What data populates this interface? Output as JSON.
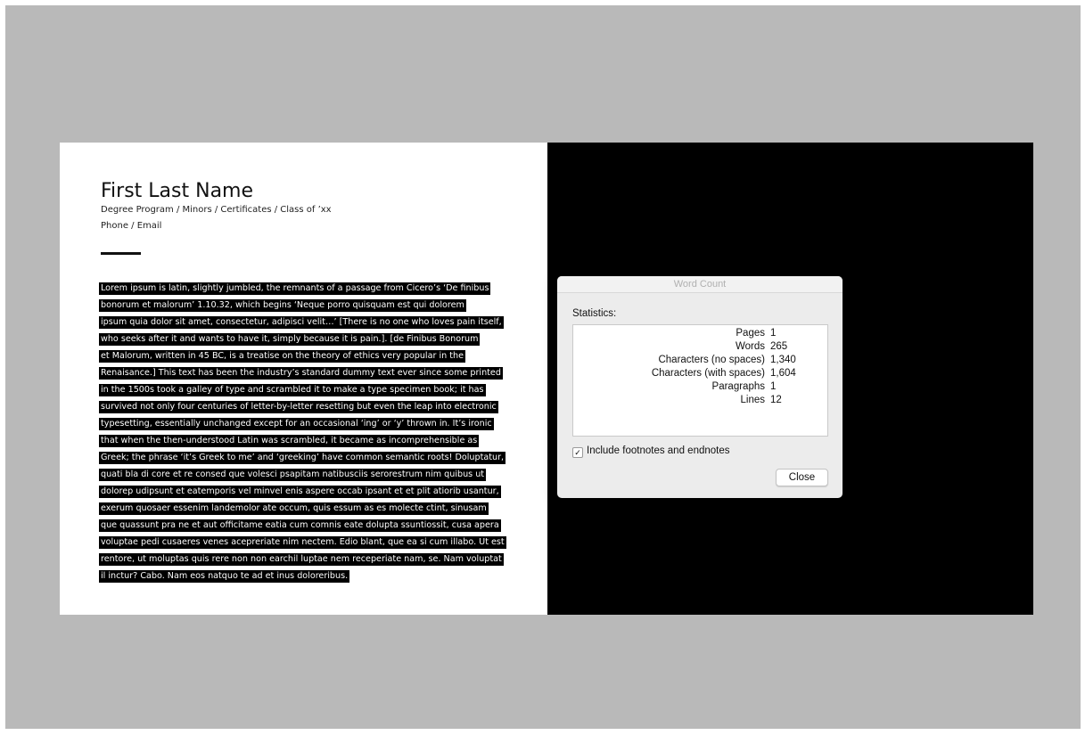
{
  "document": {
    "name": "First Last Name",
    "subtitle": "Degree Program / Minors  / Certificates / Class of ’xx",
    "contact": "Phone / Email",
    "body_lines": [
      "Lorem ipsum is latin, slightly jumbled, the remnants of a passage from Cicero’s ‘De finibus",
      "bonorum et malorum’ 1.10.32, which begins ‘Neque porro quisquam est qui dolorem",
      "ipsum quia dolor sit amet, consectetur, adipisci velit…’ [There is no one who loves pain itself,",
      "who seeks after it and wants to have it, simply because it is pain.]. [de Finibus Bonorum",
      "et Malorum, written in 45 BC, is a treatise on the theory of ethics very popular in the",
      "Renaisance.] This text has been the industry’s standard dummy text ever since some printed",
      "in the 1500s took a galley of type and scrambled it to make a type specimen book; it has",
      "survived not only four centuries of letter-by-letter resetting but even the leap into electronic",
      "typesetting, essentially unchanged except for an occasional ‘ing’ or ‘y’ thrown in. It’s ironic",
      "that when the then-understood Latin was scrambled, it became as incomprehensible as",
      "Greek; the phrase ‘it’s Greek to me’ and ‘greeking’ have common semantic roots! Doluptatur,",
      "quati bla di core et re consed que volesci psapitam natibusciis serorestrum nim quibus ut",
      "dolorep udipsunt et eatemporis vel minvel enis aspere occab ipsant et et plit atiorib usantur,",
      "exerum quosaer essenim landemolor ate occum, quis essum as es molecte ctint, sinusam",
      "que quassunt pra ne et aut officitame eatia cum comnis eate dolupta ssuntiossit, cusa apera",
      "voluptae pedi cusaeres venes acepreriate nim nectem. Edio blant, que ea si cum illabo. Ut est",
      "rentore, ut moluptas quis rere non non earchil luptae nem receperiate nam, se. Nam voluptat",
      "il inctur? Cabo. Nam eos natquo te ad et inus doloreribus."
    ]
  },
  "dialog": {
    "title": "Word Count",
    "statistics_label": "Statistics:",
    "stats": [
      {
        "label": "Pages",
        "value": "1"
      },
      {
        "label": "Words",
        "value": "265"
      },
      {
        "label": "Characters (no spaces)",
        "value": "1,340"
      },
      {
        "label": "Characters (with spaces)",
        "value": "1,604"
      },
      {
        "label": "Paragraphs",
        "value": "1"
      },
      {
        "label": "Lines",
        "value": "12"
      }
    ],
    "checkbox_checked": true,
    "checkbox_mark": "✓",
    "checkbox_label": "Include footnotes and endnotes",
    "close_label": "Close"
  },
  "colors": {
    "backdrop": "#b9b9b9",
    "selection_highlight": "#000000",
    "dialog_background": "#ececec"
  }
}
